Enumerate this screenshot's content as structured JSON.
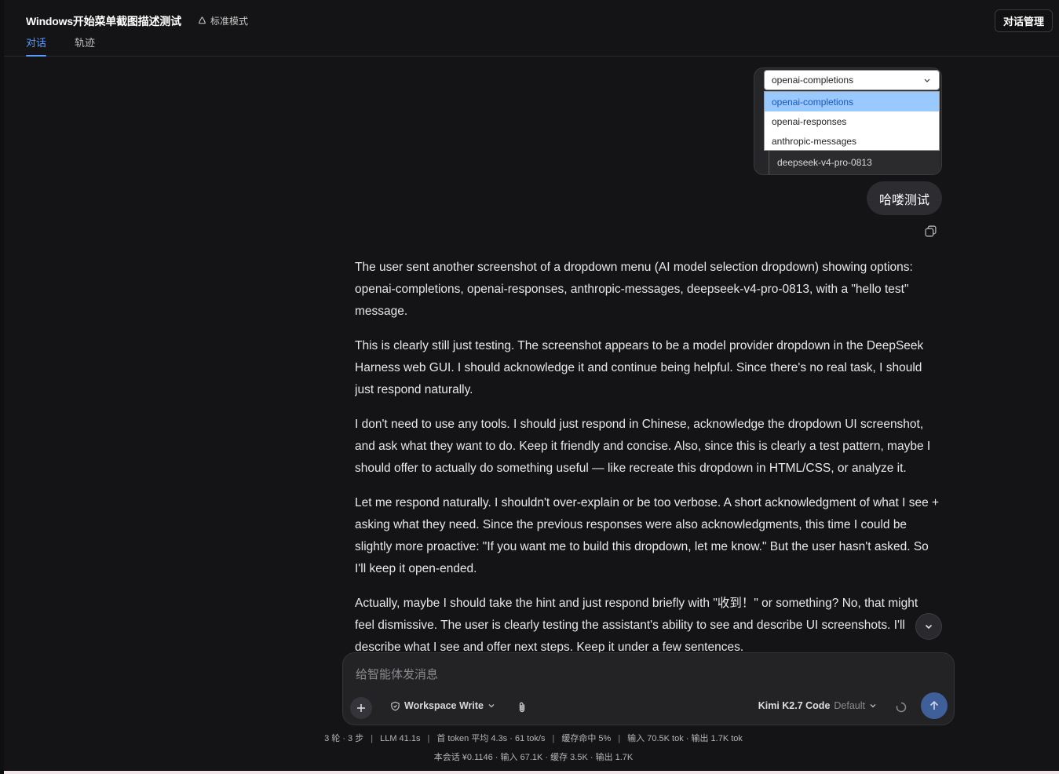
{
  "header": {
    "title": "Windows开始菜单截图描述测试",
    "mode": "标准模式",
    "tabs": [
      {
        "label": "对话",
        "active": true
      },
      {
        "label": "轨迹",
        "active": false
      }
    ],
    "manage_button": "对话管理"
  },
  "attachment": {
    "selected": "openai-completions",
    "options": [
      "openai-completions",
      "openai-responses",
      "anthropic-messages"
    ],
    "extra_item": "deepseek-v4-pro-0813"
  },
  "user_message": "哈喽测试",
  "assistant": {
    "paragraphs": [
      "The user sent another screenshot of a dropdown menu (AI model selection dropdown) showing options: openai-completions, openai-responses, anthropic-messages, deepseek-v4-pro-0813, with a \"hello test\" message.",
      "This is clearly still just testing. The screenshot appears to be a model provider dropdown in the DeepSeek Harness web GUI. I should acknowledge it and continue being helpful. Since there's no real task, I should just respond naturally.",
      "I don't need to use any tools. I should just respond in Chinese, acknowledge the dropdown UI screenshot, and ask what they want to do. Keep it friendly and concise. Also, since this is clearly a test pattern, maybe I should offer to actually do something useful — like recreate this dropdown in HTML/CSS, or analyze it.",
      "Let me respond naturally. I shouldn't over-explain or be too verbose. A short acknowledgment of what I see + asking what they need. Since the previous responses were also acknowledgments, this time I could be slightly more proactive: \"If you want me to build this dropdown, let me know.\" But the user hasn't asked. So I'll keep it open-ended.",
      "Actually, maybe I should take the hint and just respond briefly with \"收到！\" or something? No, that might feel dismissive. The user is clearly testing the assistant's ability to see and describe UI screenshots. I'll describe what I see and offer next steps. Keep it under a few sentences."
    ]
  },
  "composer": {
    "placeholder": "给智能体发消息",
    "workspace": "Workspace Write",
    "model_name": "Kimi K2.7 Code",
    "model_variant": "Default"
  },
  "stats": {
    "line1": [
      "3 轮 · 3 步",
      "LLM 41.1s",
      "首 token 平均 4.3s · 61 tok/s",
      "缓存命中 5%",
      "输入 70.5K tok · 输出 1.7K tok"
    ],
    "line2": "本会话 ¥0.1146 · 输入 67.1K · 缓存 3.5K · 输出 1.7K"
  },
  "colors": {
    "accent": "#5b9bff",
    "background": "#141416",
    "send_button": "#3f5f99",
    "selected_option": "#99c9ff"
  }
}
